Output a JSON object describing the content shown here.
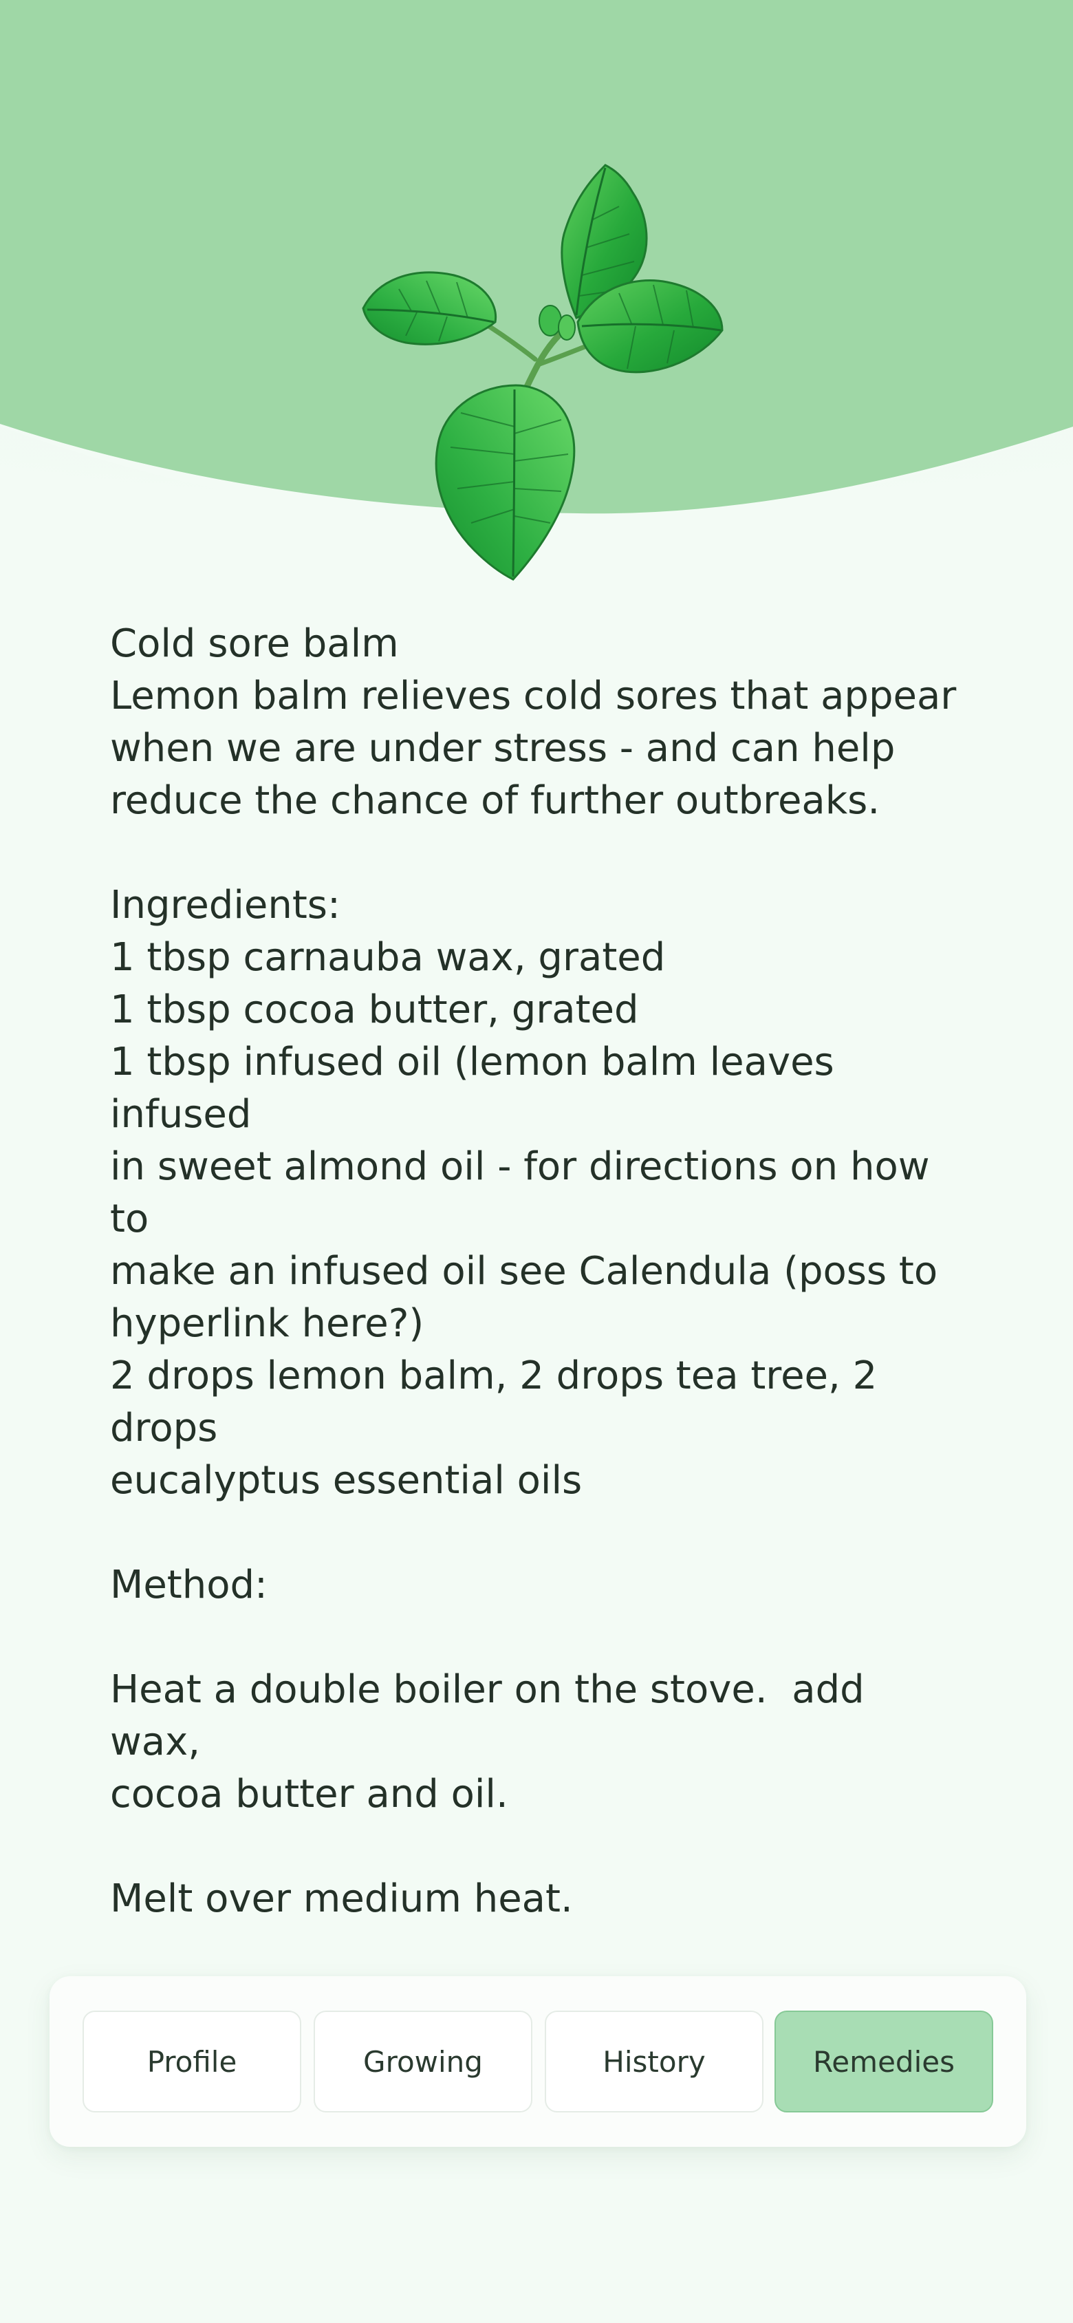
{
  "colors": {
    "header_green": "#9fd7a6",
    "page_background": "#f3fbf5",
    "active_tab": "#a8ddb4",
    "text": "#243128"
  },
  "hero": {
    "icon": "lemon-balm-leaves-illustration"
  },
  "remedy": {
    "title": "Cold sore balm",
    "intro_lines": [
      "Lemon balm relieves cold sores that appear",
      "when we are under stress - and can help",
      "reduce the chance of further outbreaks."
    ],
    "ingredients_heading": "Ingredients:",
    "ingredient_lines": [
      "1 tbsp carnauba wax, grated",
      "1 tbsp cocoa butter, grated",
      "1 tbsp infused oil (lemon balm leaves infused",
      "in sweet almond oil - for directions on how to",
      "make an infused oil see Calendula (poss to",
      "hyperlink here?)",
      "2 drops lemon balm, 2 drops tea tree, 2 drops",
      "eucalyptus essential oils"
    ],
    "method_heading": "Method:",
    "method_lines": [
      "Heat a double boiler on the stove.  add wax,",
      "cocoa butter and oil."
    ],
    "method_step2": "Melt over medium heat."
  },
  "tabs": [
    {
      "label": "Profile",
      "active": false
    },
    {
      "label": "Growing",
      "active": false
    },
    {
      "label": "History",
      "active": false
    },
    {
      "label": "Remedies",
      "active": true
    }
  ]
}
